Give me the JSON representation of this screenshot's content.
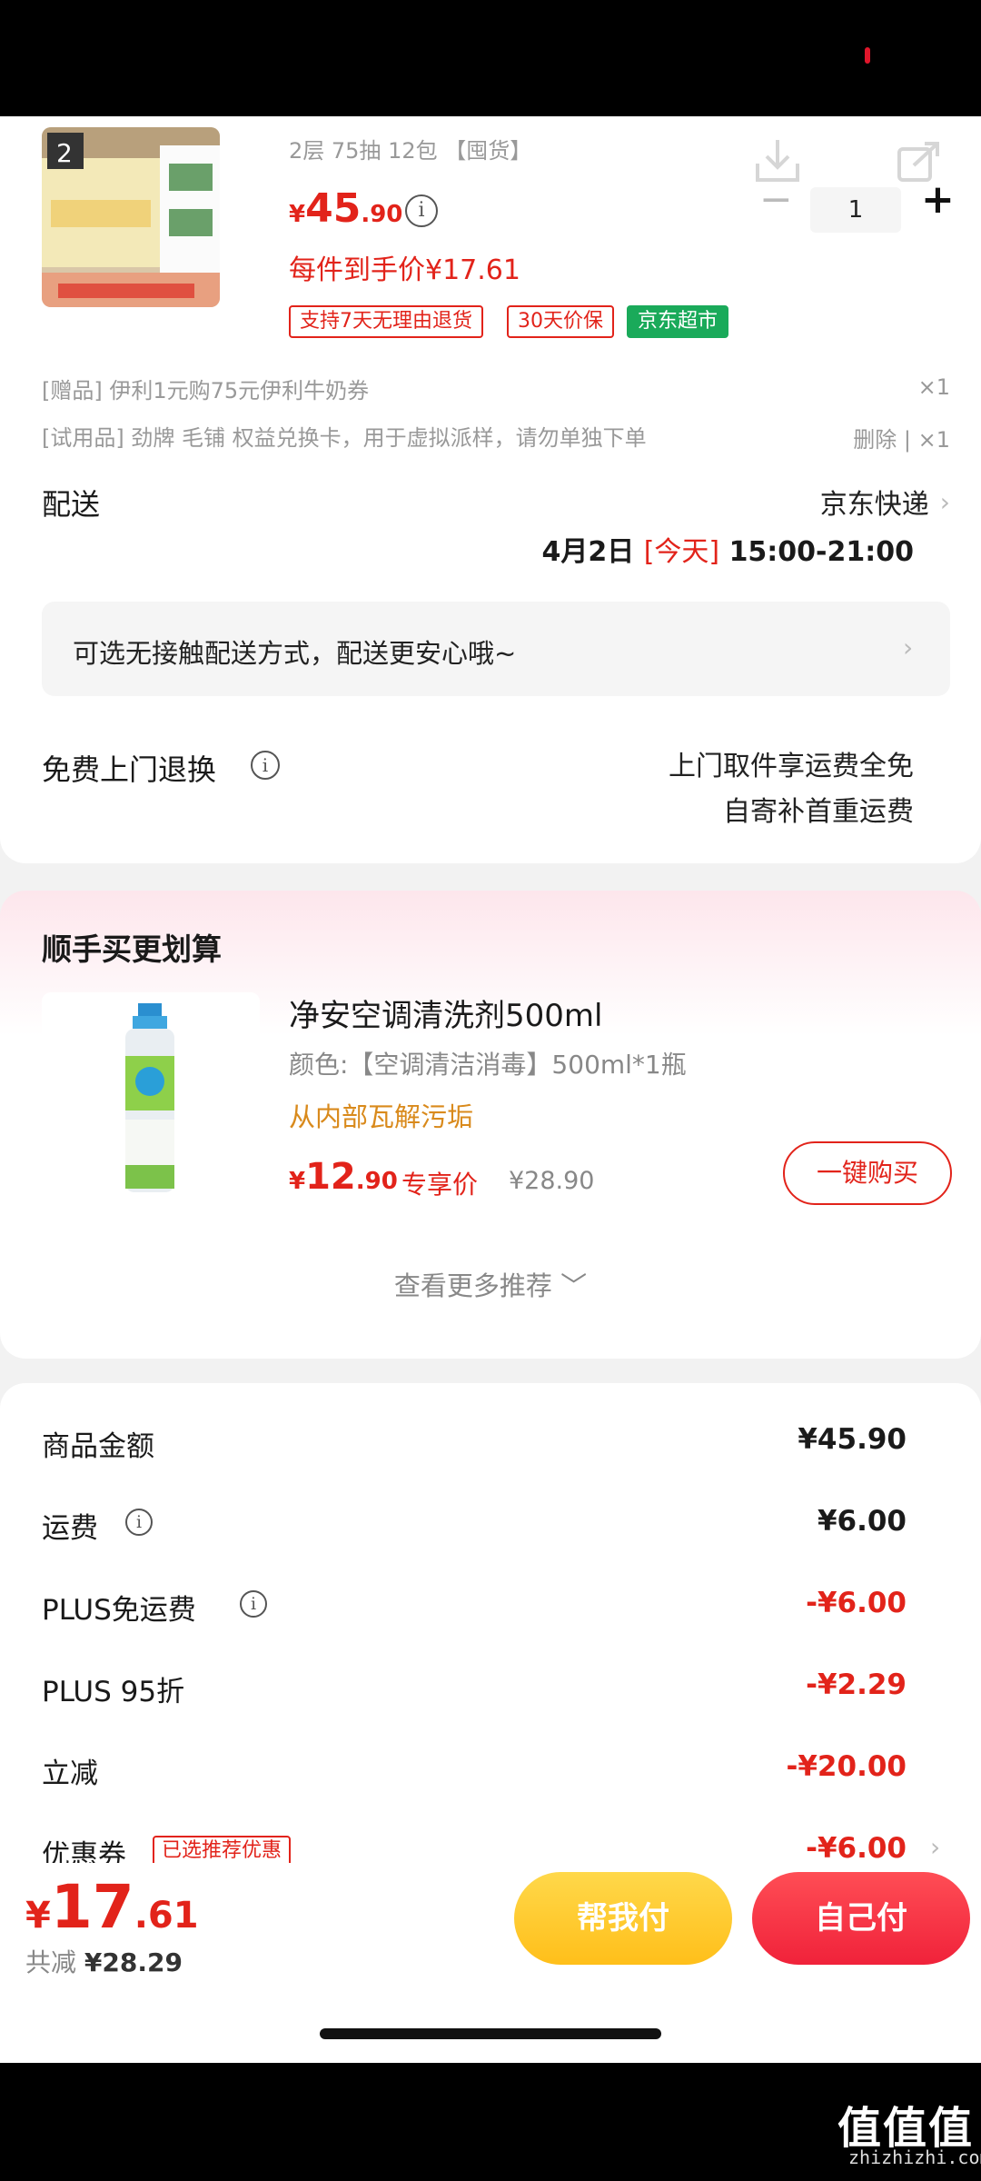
{
  "product": {
    "spec": "2层 75抽 12包 【囤货】",
    "price_yen": "¥",
    "price_int": "45",
    "price_dec": ".90",
    "arrive_price": "每件到手价¥17.61",
    "tags": [
      "支持7天无理由退货",
      "30天价保",
      "京东超市"
    ],
    "quantity": "1",
    "minus": "−",
    "plus": "+"
  },
  "gifts": [
    {
      "text": "[赠品] 伊利1元购75元伊利牛奶券",
      "right": "×1"
    },
    {
      "text": "[试用品] 劲牌 毛铺 权益兑换卡，用于虚拟派样，请勿单独下单",
      "right": "删除 | ×1"
    }
  ],
  "delivery": {
    "label": "配送",
    "carrier": "京东快递",
    "date": "4月2日",
    "today": "[今天]",
    "time": "15:00-21:00"
  },
  "notice": "可选无接触配送方式，配送更安心哦~",
  "return_service": {
    "label": "免费上门退换",
    "line1": "上门取件享运费全免",
    "line2": "自寄补首重运费"
  },
  "recommend": {
    "title": "顺手买更划算",
    "name": "净安空调清洗剂500ml",
    "spec": "颜色:【空调清洁消毒】500ml*1瓶",
    "slogan": "从内部瓦解污垢",
    "price_yen": "¥",
    "price_int": "12",
    "price_dec": ".90",
    "exclusive": "专享价",
    "orig_price": "¥28.90",
    "buy_button": "一键购买",
    "more": "查看更多推荐 ﹀"
  },
  "summary": [
    {
      "label": "商品金额",
      "value": "¥45.90",
      "red": false
    },
    {
      "label": "运费",
      "value": "¥6.00",
      "red": false
    },
    {
      "label": "PLUS免运费",
      "value": "-¥6.00",
      "red": true
    },
    {
      "label": "PLUS 95折",
      "value": "-¥2.29",
      "red": true
    },
    {
      "label": "立减",
      "value": "-¥20.00",
      "red": true
    },
    {
      "label": "优惠券",
      "value": "-¥6.00",
      "red": true
    }
  ],
  "coupon_tag": "已选推荐优惠",
  "bottom": {
    "total_yen": "¥",
    "total_int": "17",
    "total_dec": ".61",
    "saved_label": "共减",
    "saved_value": "¥28.29",
    "pay_friend": "帮我付",
    "pay_self": "自己付"
  },
  "watermark": {
    "logo": "值值值",
    "url": "zhizhizhi.com"
  },
  "colors": {
    "accent_red": "#e2231a",
    "jd_green": "#1aaa5a",
    "friend_yellow": "#ffc51f",
    "slogan_orange": "#d98a1c"
  },
  "icons": [
    "download-icon",
    "share-icon",
    "info-icon",
    "chevron-right-icon"
  ]
}
